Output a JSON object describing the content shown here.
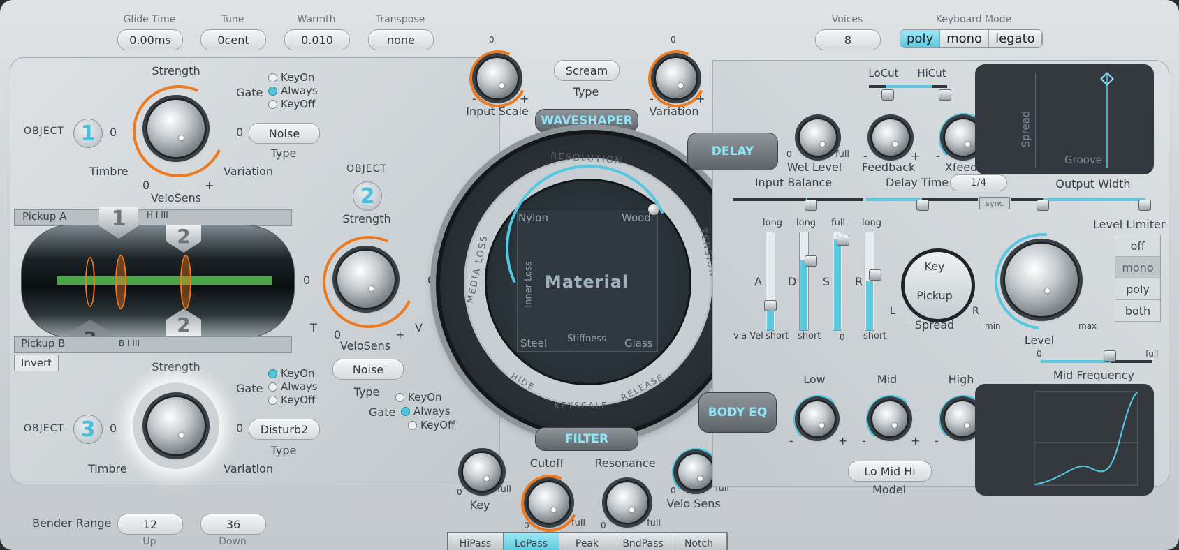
{
  "top": {
    "glide": {
      "label": "Glide Time",
      "value": "0.00ms"
    },
    "tune": {
      "label": "Tune",
      "value": "0cent"
    },
    "warmth": {
      "label": "Warmth",
      "value": "0.010"
    },
    "transpose": {
      "label": "Transpose",
      "value": "none"
    },
    "voices": {
      "label": "Voices",
      "value": "8"
    },
    "keyboard_mode": {
      "label": "Keyboard Mode",
      "options": [
        "poly",
        "mono",
        "legato"
      ],
      "selected": "poly"
    }
  },
  "object1": {
    "label": "OBJECT",
    "number": "1",
    "strength": "Strength",
    "timbre": "Timbre",
    "variation": "Variation",
    "velosens": "VeloSens",
    "zero": "0",
    "plus": "+",
    "gate": {
      "label": "Gate",
      "options": [
        "KeyOn",
        "Always",
        "KeyOff"
      ],
      "selected": "Always"
    },
    "type": {
      "value": "Noise",
      "label": "Type"
    }
  },
  "object2": {
    "label": "OBJECT",
    "number": "2",
    "strength": "Strength",
    "t": "T",
    "v": "V",
    "velosens": "VeloSens",
    "zero": "0",
    "plus": "+",
    "type": {
      "value": "Noise",
      "label": "Type"
    },
    "gate": {
      "label": "Gate",
      "options": [
        "KeyOn",
        "Always",
        "KeyOff"
      ],
      "selected": "Always"
    }
  },
  "object3": {
    "label": "OBJECT",
    "number": "3",
    "strength": "Strength",
    "timbre": "Timbre",
    "variation": "Variation",
    "zero": "0",
    "plus": "+",
    "gate": {
      "label": "Gate",
      "options": [
        "KeyOn",
        "Always",
        "KeyOff"
      ],
      "selected": "KeyOn"
    },
    "type": {
      "value": "Disturb2",
      "label": "Type"
    }
  },
  "pickup": {
    "a": "Pickup A",
    "b": "Pickup B",
    "invert": "Invert",
    "m1": "1",
    "m2": "2",
    "m3": "3",
    "scale": "H  I  III",
    "scale_b": "B   I  III"
  },
  "waveshaper": {
    "input_scale": "Input Scale",
    "type_value": "Scream",
    "type_label": "Type",
    "variation": "Variation",
    "title": "WAVESHAPER",
    "zero": "0",
    "minus": "-",
    "plus": "+"
  },
  "material": {
    "title": "Material",
    "resolution": "RESOLUTION",
    "media_loss": "MEDIA LOSS",
    "tension_mod": "TENSION MOD",
    "inner_loss": "Inner Loss",
    "stiffness": "Stiffness",
    "nylon": "Nylon",
    "wood": "Wood",
    "steel": "Steel",
    "glass": "Glass",
    "hide": "HIDE",
    "keyscale": "KEYSCALE",
    "release": "RELEASE"
  },
  "filter": {
    "title": "FILTER",
    "key": "Key",
    "cutoff": "Cutoff",
    "resonance": "Resonance",
    "velo_sens": "Velo Sens",
    "zero": "0",
    "full": "full",
    "types": [
      "HiPass",
      "LoPass",
      "Peak",
      "BndPass",
      "Notch"
    ],
    "selected": "LoPass"
  },
  "bender": {
    "label": "Bender Range",
    "up": "12",
    "up_label": "Up",
    "down": "36",
    "down_label": "Down"
  },
  "delay": {
    "title": "DELAY",
    "wet_level": "Wet Level",
    "feedback": "Feedback",
    "xfeed": "Xfeed",
    "locut": "LoCut",
    "hicut": "HiCut",
    "input_balance": "Input Balance",
    "delay_time": "Delay Time",
    "delay_time_value": "1/4",
    "sync": "sync",
    "output_width": "Output Width",
    "spread": "Spread",
    "groove": "Groove",
    "zero": "0",
    "full": "full",
    "minus": "-",
    "plus": "+"
  },
  "envelope": {
    "a": "A",
    "d": "D",
    "s": "S",
    "r": "R",
    "long": "long",
    "full": "full",
    "short": "short",
    "via_vel": "via Vel",
    "zero": "0"
  },
  "spread": {
    "key": "Key",
    "pickup": "Pickup",
    "label": "Spread",
    "l": "L",
    "r": "R"
  },
  "level": {
    "label": "Level",
    "min": "min",
    "max": "max"
  },
  "limiter": {
    "label": "Level Limiter",
    "options": [
      "off",
      "mono",
      "poly",
      "both"
    ],
    "selected": "mono"
  },
  "body_eq": {
    "title": "BODY EQ",
    "mid_frequency": "Mid Frequency",
    "low": "Low",
    "mid": "Mid",
    "high": "High",
    "model_value": "Lo Mid Hi",
    "model_label": "Model",
    "zero": "0",
    "full": "full",
    "minus": "-",
    "plus": "+"
  },
  "colors": {
    "accent_cyan": "#56c7e0",
    "accent_orange": "#ee7a1f",
    "panel_dark": "#33393e"
  }
}
